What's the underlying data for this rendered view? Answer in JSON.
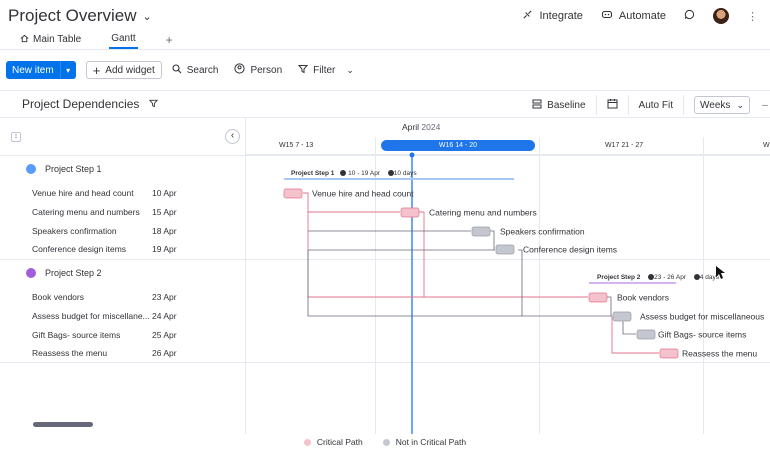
{
  "header": {
    "title": "Project Overview",
    "integrate_label": "Integrate",
    "automate_label": "Automate"
  },
  "tabs": [
    {
      "label": "Main Table"
    },
    {
      "label": "Gantt"
    }
  ],
  "toolbar": {
    "new_item_label": "New item",
    "add_widget_label": "Add widget",
    "search_label": "Search",
    "person_label": "Person",
    "filter_label": "Filter"
  },
  "board": {
    "title": "Project Dependencies",
    "baseline_label": "Baseline",
    "autofit_label": "Auto Fit",
    "zoom_value": "Weeks"
  },
  "timeline": {
    "month": "April",
    "year": "2024",
    "weeks": [
      "W15 7 - 13",
      "W16 14 - 20",
      "W17 21 - 27",
      "W"
    ],
    "current_week": "W16 14 - 20"
  },
  "groups": [
    {
      "name": "Project Step 1",
      "color": "#579bfc",
      "summary_name": "Project Step 1",
      "summary_range": "10 - 19 Apr",
      "summary_duration": "10 days",
      "items": [
        {
          "name": "Venue hire and head count",
          "date": "10 Apr",
          "bar_label": "Venue hire and head count",
          "critical": true
        },
        {
          "name": "Catering menu and numbers",
          "date": "15 Apr",
          "bar_label": "Catering menu and numbers",
          "critical": true
        },
        {
          "name": "Speakers confirmation",
          "date": "18 Apr",
          "bar_label": "Speakers confirmation",
          "critical": false
        },
        {
          "name": "Conference design items",
          "date": "19 Apr",
          "bar_label": "Conference design items",
          "critical": false
        }
      ]
    },
    {
      "name": "Project Step 2",
      "color": "#a25ddc",
      "summary_name": "Project Step 2",
      "summary_range": "23 - 26 Apr",
      "summary_duration": "4 days",
      "items": [
        {
          "name": "Book vendors",
          "date": "23 Apr",
          "bar_label": "Book vendors",
          "critical": true
        },
        {
          "name": "Assess budget for miscellane...",
          "date": "24 Apr",
          "bar_label": "Assess budget for miscellaneous",
          "critical": false
        },
        {
          "name": "Gift Bags- source items",
          "date": "25 Apr",
          "bar_label": "Gift Bags- source items",
          "critical": false
        },
        {
          "name": "Reassess the menu",
          "date": "26 Apr",
          "bar_label": "Reassess the menu",
          "critical": true
        }
      ]
    }
  ],
  "legend": {
    "critical_label": "Critical Path",
    "noncritical_label": "Not in Critical Path"
  },
  "colors": {
    "accent": "#0073ea",
    "critical_fill": "#f4c2cc",
    "critical_stroke": "#e3738b",
    "noncritical_fill": "#c5c7d0",
    "noncritical_stroke": "#9a9ca6",
    "today_line": "#1f76eb"
  }
}
